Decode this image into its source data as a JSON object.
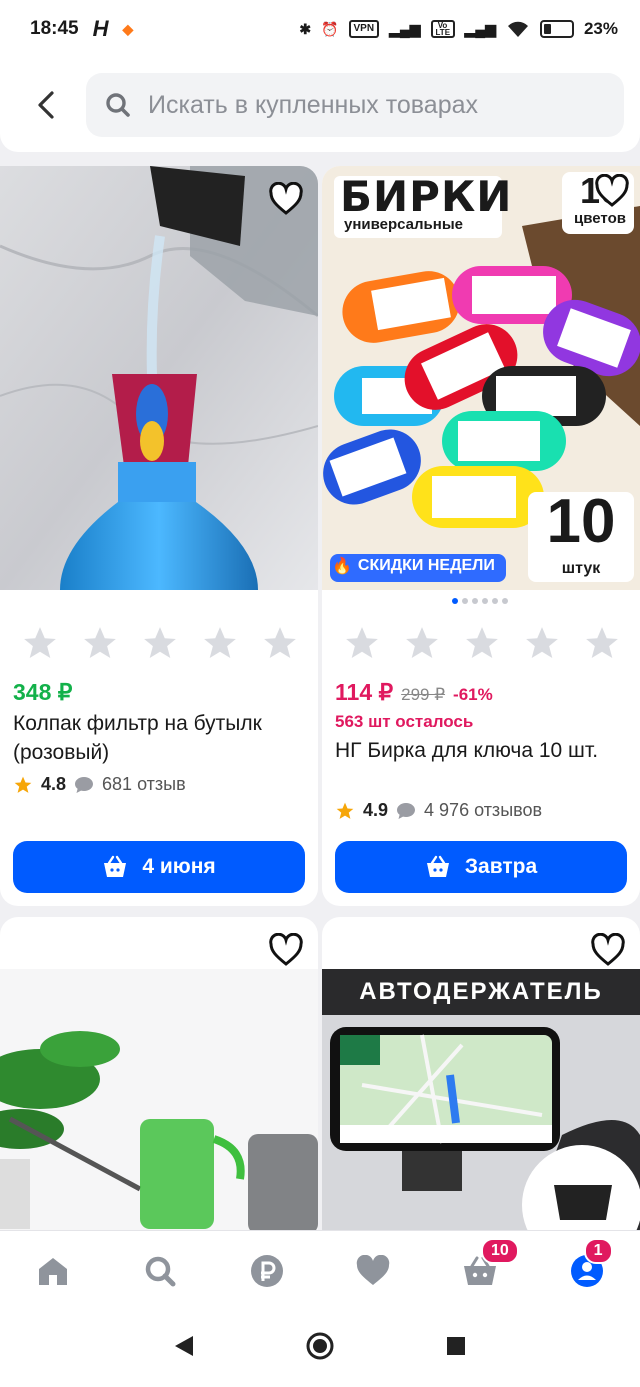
{
  "status_bar": {
    "time": "18:45",
    "net_label": "VPN",
    "volte_label": "Vo LTE",
    "battery": "23%"
  },
  "search": {
    "placeholder": "Искать в купленных товарах"
  },
  "tags": {
    "birki_title": "БИРКИ",
    "birki_sub": "универсальные",
    "colors_num": "10",
    "colors_word": "цветов",
    "count_num": "10",
    "count_word": "штук",
    "promo": "СКИДКИ НЕДЕЛИ",
    "holder_banner": "АВТОДЕРЖАТЕЛЬ"
  },
  "products": [
    {
      "price": "348 ₽",
      "title": "Колпак фильтр на бутылк (розовый)",
      "rating": "4.8",
      "reviews": "681 отзыв",
      "delivery": "4 июня",
      "stars_total": 5
    },
    {
      "price": "114 ₽",
      "old_price": "299 ₽",
      "discount": "-61%",
      "remaining": "563 шт осталось",
      "title": "НГ Бирка для ключа 10 шт.",
      "rating": "4.9",
      "reviews": "4 976 отзывов",
      "delivery": "Завтра",
      "stars_total": 5
    }
  ],
  "nav": {
    "cart_badge": "10",
    "profile_badge": "1",
    "items": [
      "home-icon",
      "search-icon",
      "ruble-icon",
      "heart-icon",
      "cart-icon",
      "profile-icon"
    ]
  },
  "colors": {
    "accent": "#005bff",
    "price_green": "#13b14a",
    "price_pink": "#e0195f"
  }
}
